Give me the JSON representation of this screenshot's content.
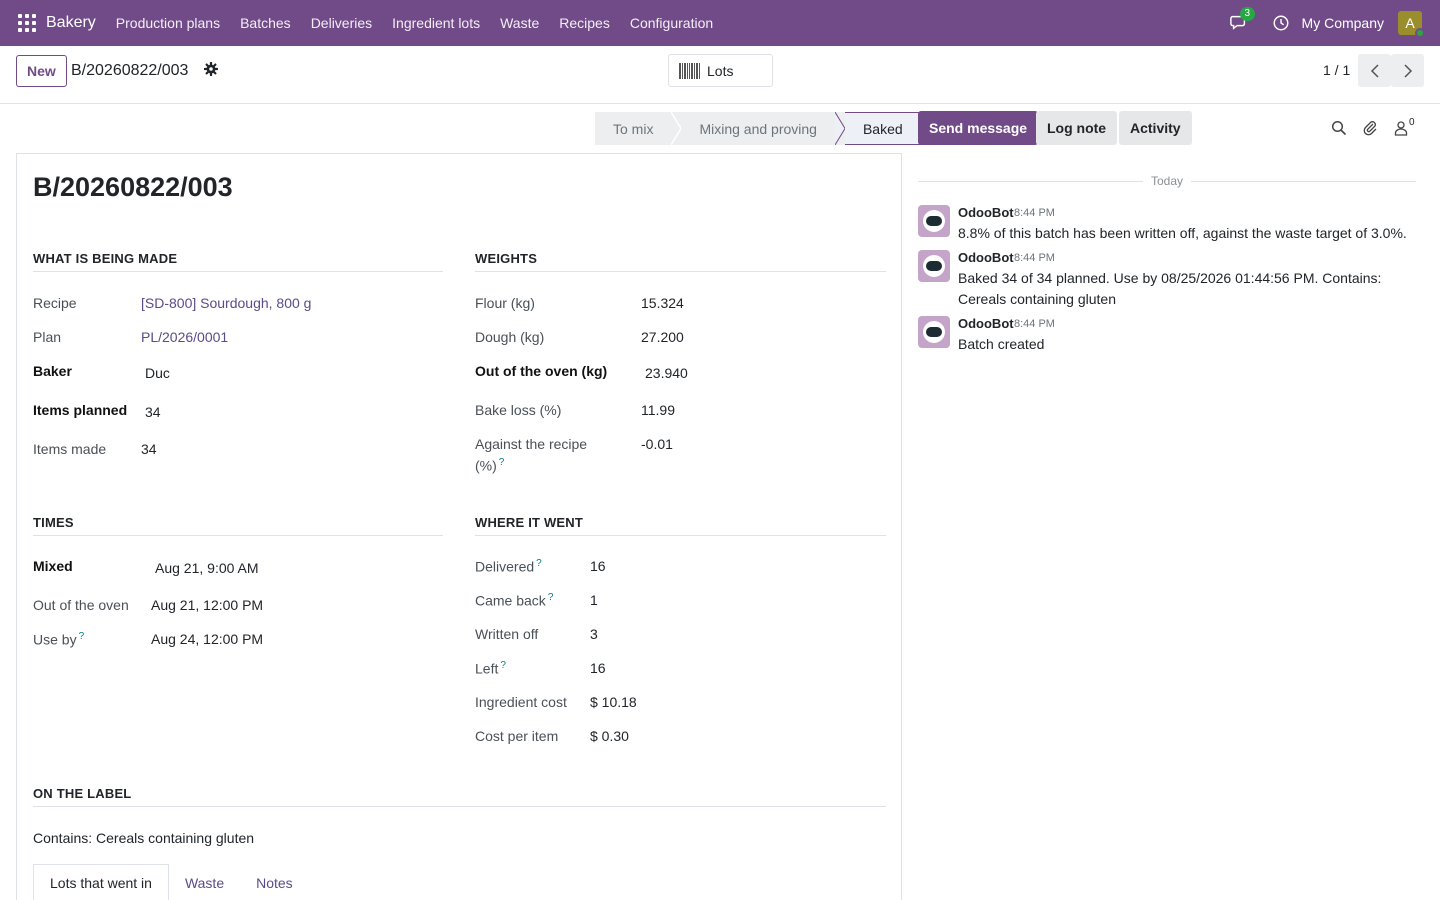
{
  "navbar": {
    "brand": "Bakery",
    "menu": [
      "Production plans",
      "Batches",
      "Deliveries",
      "Ingredient lots",
      "Waste",
      "Recipes",
      "Configuration"
    ],
    "chat_count": "3",
    "company": "My Company",
    "avatar_letter": "A"
  },
  "control": {
    "new_label": "New",
    "breadcrumb": "B/20260822/003",
    "lots_label": "Lots",
    "pager": "1 / 1"
  },
  "status": {
    "stages": [
      "To mix",
      "Mixing and proving",
      "Baked"
    ],
    "active": "Baked"
  },
  "form": {
    "title": "B/20260822/003",
    "what": {
      "heading": "WHAT IS BEING MADE",
      "recipe_label": "Recipe",
      "recipe": "[SD-800] Sourdough, 800 g",
      "plan_label": "Plan",
      "plan": "PL/2026/0001",
      "baker_label": "Baker",
      "baker": "Duc",
      "planned_label": "Items planned",
      "planned": "34",
      "made_label": "Items made",
      "made": "34"
    },
    "weights": {
      "heading": "WEIGHTS",
      "flour_label": "Flour (kg)",
      "flour": "15.324",
      "dough_label": "Dough (kg)",
      "dough": "27.200",
      "oven_label": "Out of the oven (kg)",
      "oven": "23.940",
      "loss_label": "Bake loss (%)",
      "loss": "11.99",
      "against_label_1": "Against the recipe",
      "against_label_2": "(%)",
      "against": "-0.01"
    },
    "times": {
      "heading": "TIMES",
      "mixed_label": "Mixed",
      "mixed": "Aug 21, 9:00 AM",
      "oven_label": "Out of the oven",
      "oven": "Aug 21, 12:00 PM",
      "useby_label": "Use by",
      "useby": "Aug 24, 12:00 PM"
    },
    "where": {
      "heading": "WHERE IT WENT",
      "delivered_label": "Delivered",
      "delivered": "16",
      "back_label": "Came back",
      "back": "1",
      "written_label": "Written off",
      "written": "3",
      "left_label": "Left",
      "left": "16",
      "cost_label": "Ingredient cost",
      "cost": "$ 10.18",
      "per_item_label": "Cost per item",
      "per_item": "$ 0.30"
    },
    "label_section": {
      "heading": "ON THE LABEL",
      "text": "Contains: Cereals containing gluten"
    },
    "tabs": [
      "Lots that went in",
      "Waste",
      "Notes"
    ],
    "help_mark": "?"
  },
  "chatter": {
    "send_label": "Send message",
    "log_label": "Log note",
    "activity_label": "Activity",
    "followers": "0",
    "today": "Today",
    "messages": [
      {
        "author": "OdooBot",
        "time": "8:44 PM",
        "body": "8.8% of this batch has been written off, against the waste target of 3.0%."
      },
      {
        "author": "OdooBot",
        "time": "8:44 PM",
        "body": "Baked 34 of 34 planned. Use by 08/25/2026 01:44:56 PM. Contains: Cereals containing gluten"
      },
      {
        "author": "OdooBot",
        "time": "8:44 PM",
        "body": "Batch created"
      }
    ]
  }
}
